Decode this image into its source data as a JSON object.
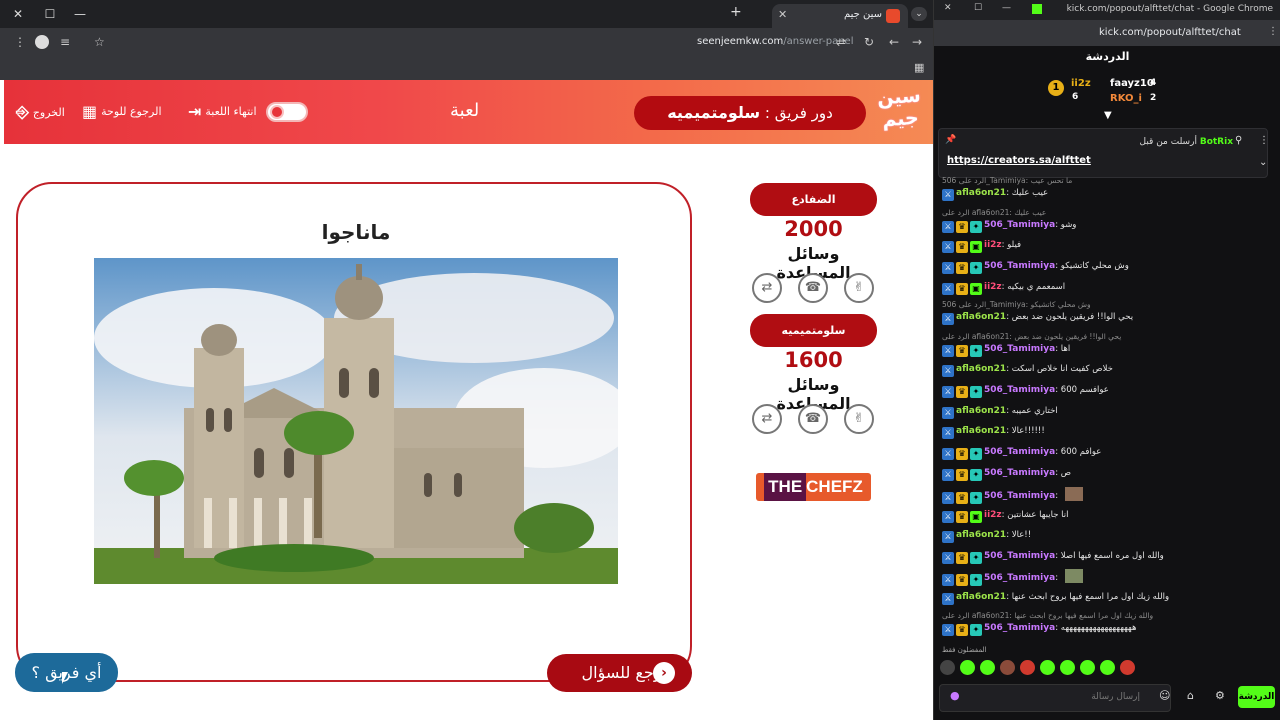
{
  "browser": {
    "tab_title": "سين جيم",
    "url_host": "seenjeemkw.com",
    "url_path": "/answer-panel"
  },
  "header": {
    "logo": "سين جيم",
    "turn_prefix": "دور فريق :",
    "turn_team": "سلومتميميه",
    "game_label": "لعبة",
    "end_game": "انتهاء اللعبة",
    "back_board": "الرجوع للوحة",
    "exit": "الخروج"
  },
  "question": {
    "answer": "ماناجوا",
    "back_label": "ارجع للسؤال",
    "which_team": "أي فريق ؟"
  },
  "teams": [
    {
      "name": "الضفادع",
      "score": "2000",
      "aids": "وسائل المساعدة"
    },
    {
      "name": "سلومتميميه",
      "score": "1600",
      "aids": "وسائل المساعدة"
    }
  ],
  "sponsor": {
    "the": "THE",
    "chefz": "CHEFZ"
  },
  "right_window": {
    "title": "kick.com/popout/alfttet/chat - Google Chrome",
    "url": "kick.com/popout/alfttet/chat",
    "chat_header": "الدردشة"
  },
  "leaderboard": {
    "first": "ii2z",
    "first_count": "6",
    "second": "faayz10",
    "second_count": "4",
    "third": "RKO_i",
    "third_count": "2"
  },
  "pinned": {
    "sent_by": "أرسلت من قبل",
    "bot": "BotRix",
    "link": "https://creators.sa/alfttet"
  },
  "chat": [
    {
      "user": "afla6on21",
      "color": "#9ce34a",
      "text": "عيب عليك"
    },
    {
      "user": "506_Tamimiya",
      "color": "#c879ff",
      "text": "وشو"
    },
    {
      "user": "ii2z",
      "color": "#ff4d7a",
      "text": "فيلو"
    },
    {
      "user": "506_Tamimiya",
      "color": "#c879ff",
      "text": "وش محلي كاتشيكو"
    },
    {
      "user": "ii2z",
      "color": "#ff4d7a",
      "text": "اسمعمم ي بيكيه"
    },
    {
      "user": "afla6on21",
      "color": "#9ce34a",
      "text": "يحي الوا!! فريقين يلحون ضد بعض"
    },
    {
      "user": "506_Tamimiya",
      "color": "#c879ff",
      "text": "اها"
    },
    {
      "user": "afla6on21",
      "color": "#9ce34a",
      "text": "خلاص كفيت انا خلاص اسكت"
    },
    {
      "user": "506_Tamimiya",
      "color": "#c879ff",
      "text": "600 عوافسم"
    },
    {
      "user": "afla6on21",
      "color": "#9ce34a",
      "text": "اختاري عميبه"
    },
    {
      "user": "afla6on21",
      "color": "#9ce34a",
      "text": "عالا!!!!!!"
    },
    {
      "user": "506_Tamimiya",
      "color": "#c879ff",
      "text": "600 عوافم"
    },
    {
      "user": "506_Tamimiya",
      "color": "#c879ff",
      "text": "ص"
    },
    {
      "user": "506_Tamimiya",
      "color": "#c879ff",
      "text": ""
    },
    {
      "user": "ii2z",
      "color": "#ff4d7a",
      "text": "انا جايبها عشانتين"
    },
    {
      "user": "afla6on21",
      "color": "#9ce34a",
      "text": "عالا!!"
    },
    {
      "user": "506_Tamimiya",
      "color": "#c879ff",
      "text": "والله اول مره اسمع فيها اصلا"
    },
    {
      "user": "506_Tamimiya",
      "color": "#c879ff",
      "text": ""
    },
    {
      "user": "afla6on21",
      "color": "#9ce34a",
      "text": "والله زيك اول مرا اسمع فيها بروح ابحث عنها"
    },
    {
      "user": "506_Tamimiya",
      "color": "#c879ff",
      "text": "ههههههههههههههههههه"
    }
  ],
  "replies": {
    "r1": "الرد على 506_Tamimiya: ما تحس عيب",
    "r2": "الرد على afla6on21: عيب عليك",
    "r3": "الرد على 506_Tamimiya: وش محلي كاتشيكو",
    "r4": "الرد على afla6on21: يحي الوا!! فريقين يلحون ضد بعض",
    "r5": "الرد على afla6on21: والله زيك اول مرا اسمع فيها بروح ابحث عنها"
  },
  "favorites_label": "المفضلون فقط",
  "chat_input": {
    "placeholder": "إرسال رسالة",
    "send": "الدردشة"
  }
}
